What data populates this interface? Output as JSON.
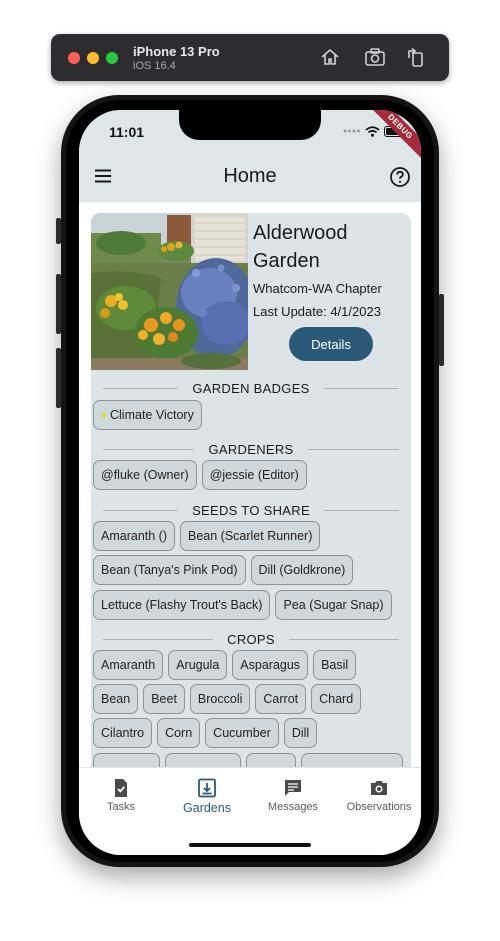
{
  "simulator": {
    "device": "iPhone 13 Pro",
    "os": "iOS 16.4",
    "icons": [
      "home-icon",
      "screenshot-icon",
      "rotate-icon"
    ]
  },
  "status_bar": {
    "time": "11:01",
    "debug_banner": "DEBUG"
  },
  "app_bar": {
    "title": "Home",
    "menu_icon": "menu-icon",
    "help_icon": "help-icon"
  },
  "garden": {
    "name": "Alderwood Garden",
    "chapter": "Whatcom-WA Chapter",
    "last_update": "Last Update: 4/1/2023",
    "details_label": "Details"
  },
  "sections": {
    "badges": {
      "title": "GARDEN BADGES",
      "items": [
        "Climate Victory"
      ]
    },
    "gardeners": {
      "title": "GARDENERS",
      "items": [
        "@fluke (Owner)",
        "@jessie (Editor)"
      ]
    },
    "seeds": {
      "title": "SEEDS TO SHARE",
      "items": [
        "Amaranth ()",
        "Bean (Scarlet Runner)",
        "Bean (Tanya's Pink Pod)",
        "Dill (Goldkrone)",
        "Lettuce (Flashy Trout's Back)",
        "Pea (Sugar Snap)"
      ]
    },
    "crops": {
      "title": "CROPS",
      "items": [
        "Amaranth",
        "Arugula",
        "Asparagus",
        "Basil",
        "Bean",
        "Beet",
        "Broccoli",
        "Carrot",
        "Chard",
        "Cilantro",
        "Corn",
        "Cucumber",
        "Dill"
      ]
    }
  },
  "bottom_nav": {
    "items": [
      {
        "label": "Tasks",
        "icon": "tasks-icon"
      },
      {
        "label": "Gardens",
        "icon": "gardens-icon",
        "active": true
      },
      {
        "label": "Messages",
        "icon": "messages-icon"
      },
      {
        "label": "Observations",
        "icon": "camera-icon"
      }
    ]
  },
  "colors": {
    "primary": "#2a5a78",
    "card_background": "#dde4e8",
    "chip_background": "#cfd8dc",
    "debug_ribbon": "#a52a3a"
  }
}
